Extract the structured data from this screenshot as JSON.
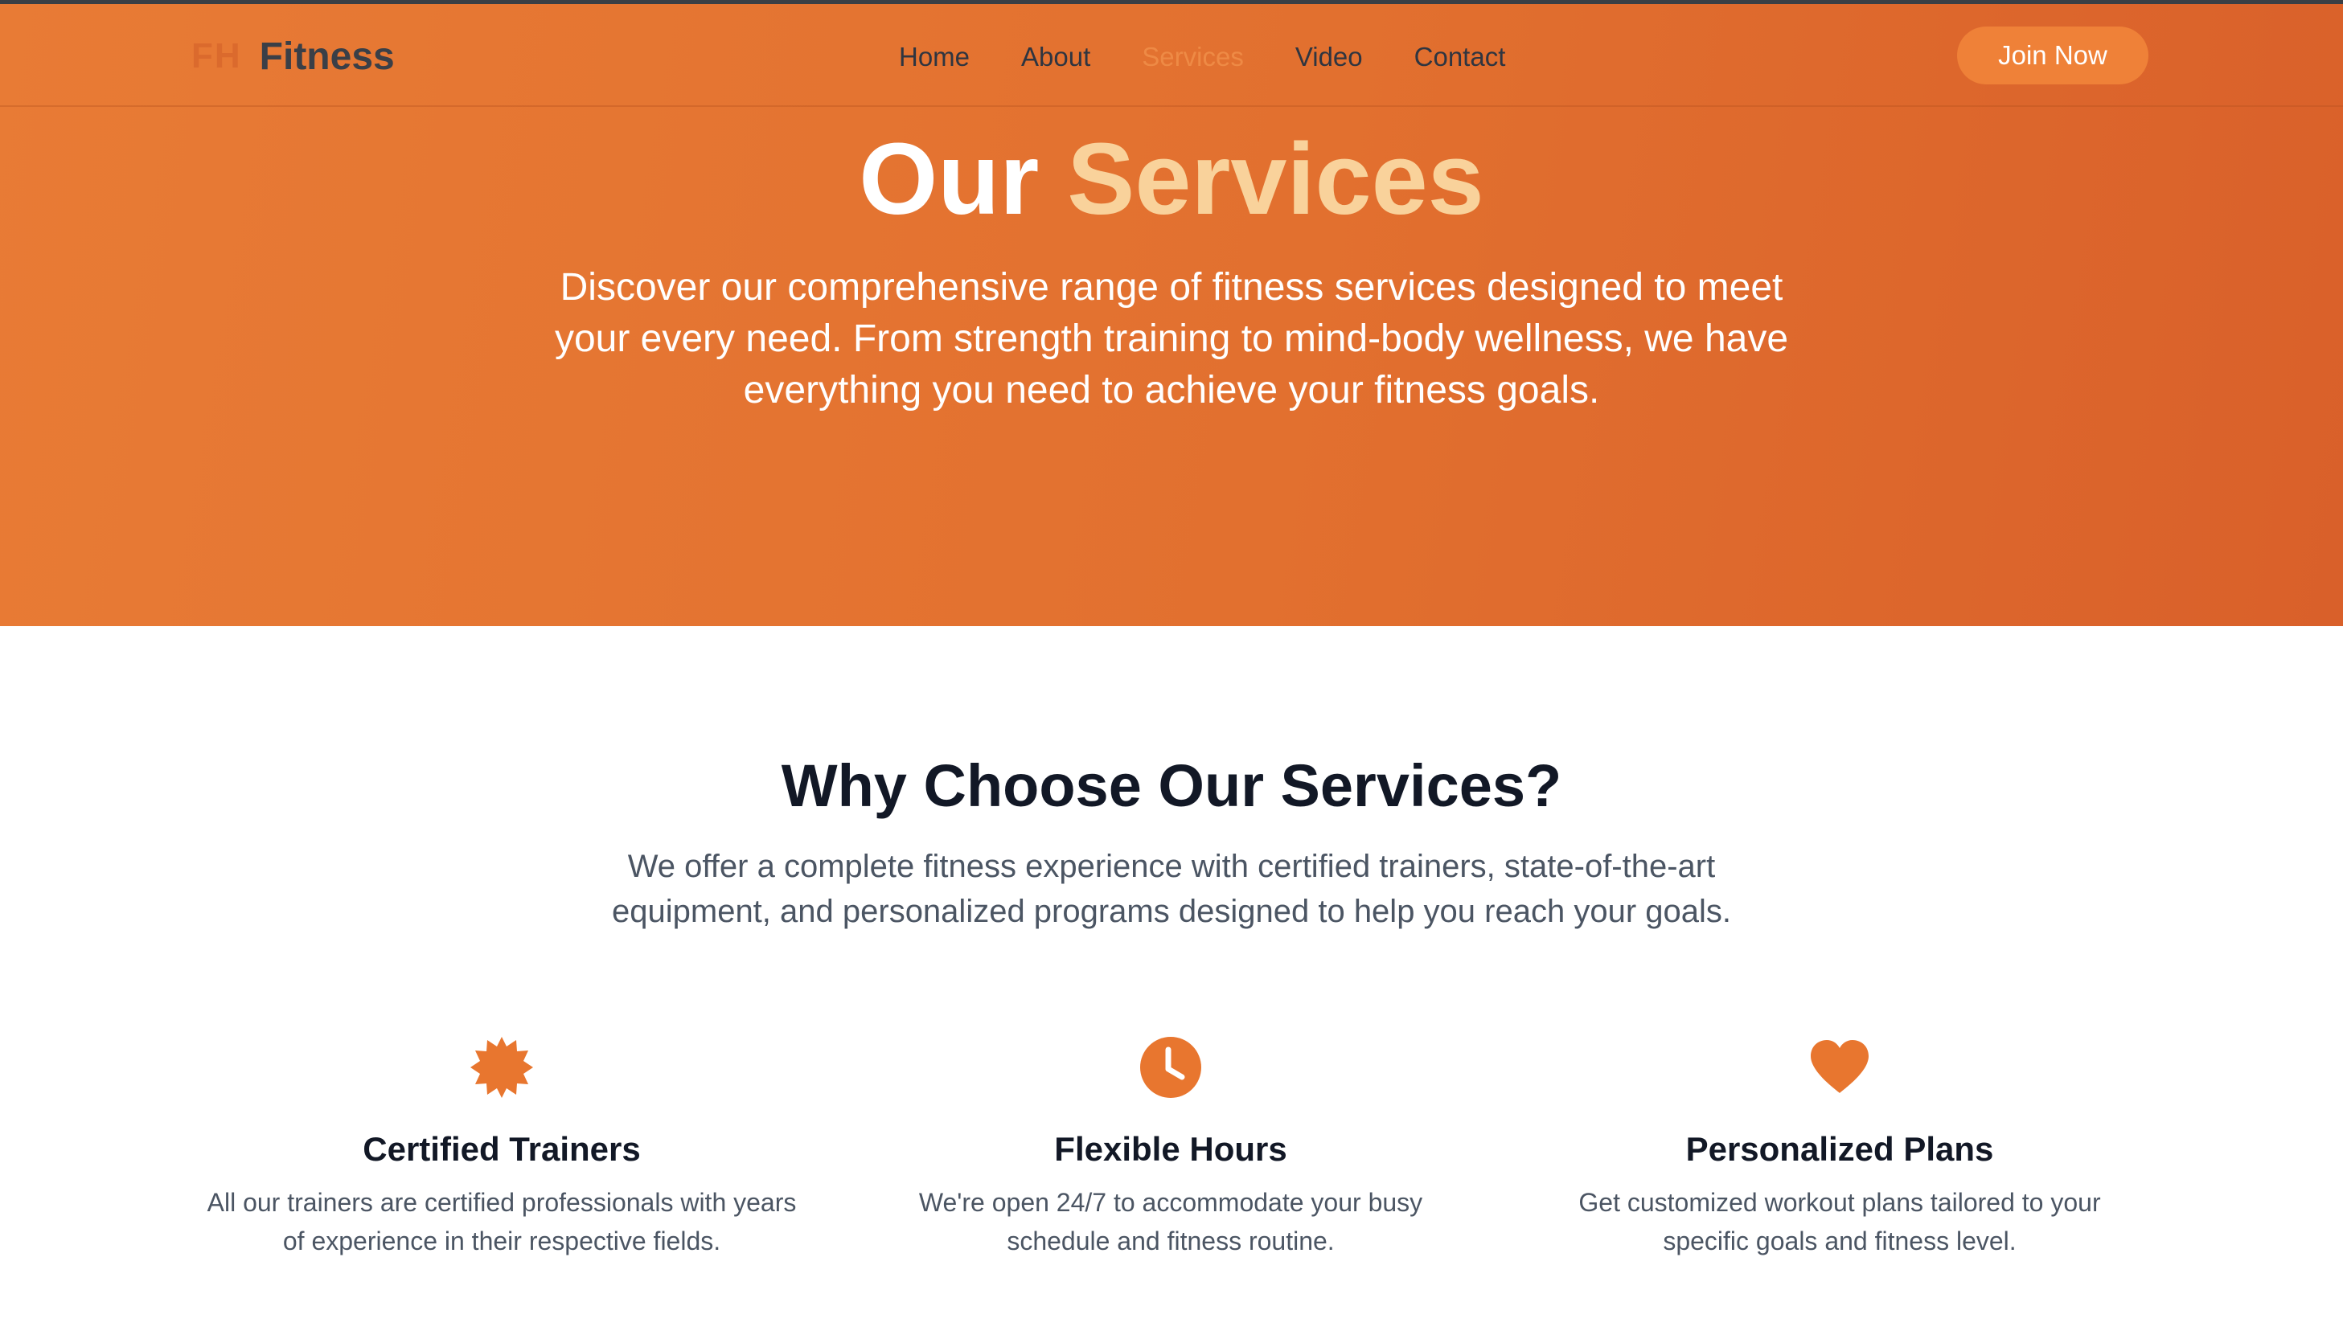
{
  "colors": {
    "brand_orange": "#e8762f",
    "accent_peach": "#f9d29b",
    "button_orange": "#ef8138",
    "dark_text": "#121826",
    "muted_text": "#4b5563"
  },
  "navbar": {
    "brand_mark": "FH",
    "brand_name": "Fitness",
    "links": [
      {
        "label": "Home",
        "active": false
      },
      {
        "label": "About",
        "active": false
      },
      {
        "label": "Services",
        "active": true
      },
      {
        "label": "Video",
        "active": false
      },
      {
        "label": "Contact",
        "active": false
      }
    ],
    "cta_label": "Join Now"
  },
  "hero": {
    "title_part1": "Our",
    "title_part2": "Services",
    "description": "Discover our comprehensive range of fitness services designed to meet your every need. From strength training to mind-body wellness, we have everything you need to achieve your fitness goals."
  },
  "why": {
    "title": "Why Choose Our Services?",
    "description": "We offer a complete fitness experience with certified trainers, state-of-the-art equipment, and personalized programs designed to help you reach your goals."
  },
  "features": [
    {
      "icon": "badge-icon",
      "title": "Certified Trainers",
      "text": "All our trainers are certified professionals with years of experience in their respective fields."
    },
    {
      "icon": "clock-icon",
      "title": "Flexible Hours",
      "text": "We're open 24/7 to accommodate your busy schedule and fitness routine."
    },
    {
      "icon": "heart-icon",
      "title": "Personalized Plans",
      "text": "Get customized workout plans tailored to your specific goals and fitness level."
    }
  ]
}
